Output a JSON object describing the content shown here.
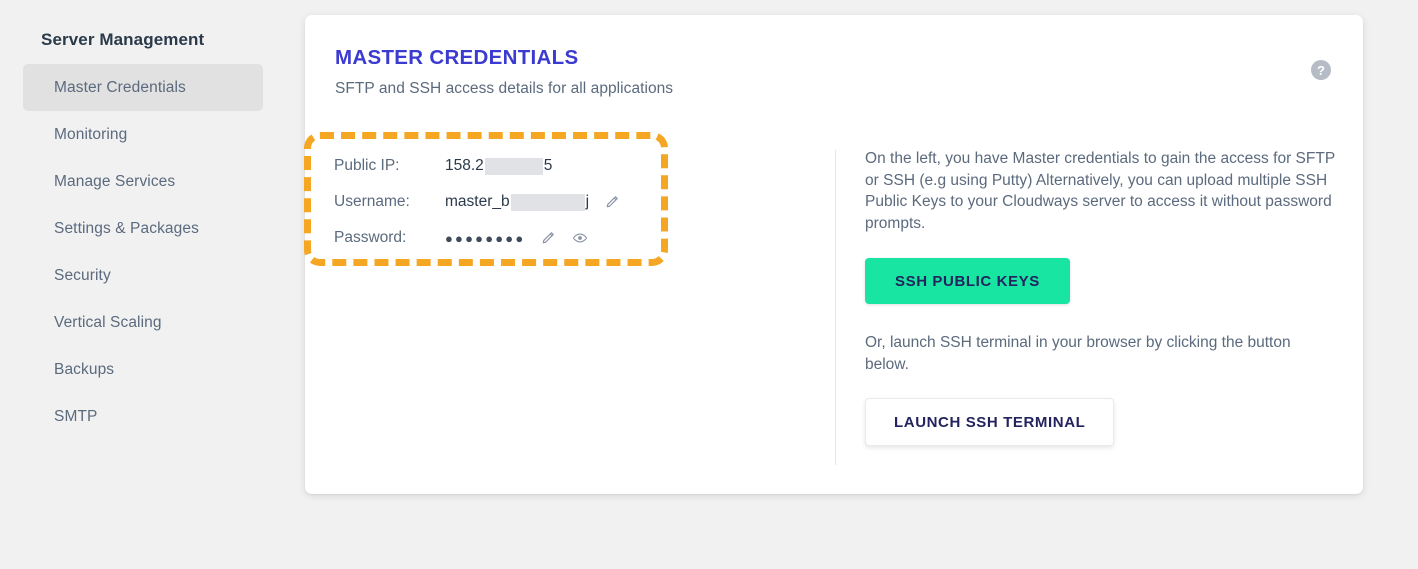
{
  "sidebar": {
    "title": "Server Management",
    "items": [
      {
        "label": "Master Credentials",
        "active": true
      },
      {
        "label": "Monitoring",
        "active": false
      },
      {
        "label": "Manage Services",
        "active": false
      },
      {
        "label": "Settings & Packages",
        "active": false
      },
      {
        "label": "Security",
        "active": false
      },
      {
        "label": "Vertical Scaling",
        "active": false
      },
      {
        "label": "Backups",
        "active": false
      },
      {
        "label": "SMTP",
        "active": false
      }
    ]
  },
  "card": {
    "title": "MASTER CREDENTIALS",
    "subtitle": "SFTP and SSH access details for all applications",
    "help_icon_glyph": "?",
    "help_icon_name": "question-mark-icon"
  },
  "credentials": {
    "rows": [
      {
        "label": "Public IP:",
        "value_prefix": "158.2",
        "value_suffix": "5",
        "redacted": true
      },
      {
        "label": "Username:",
        "value_prefix": "master_b",
        "value_suffix": "j",
        "redacted": true
      },
      {
        "label": "Password:",
        "value_masked": "●●●●●●●●",
        "redacted": false
      }
    ]
  },
  "right": {
    "description": "On the left, you have Master credentials to gain the access for SFTP or SSH (e.g using Putty) Alternatively, you can upload multiple SSH Public Keys to your Cloudways server to access it without password prompts.",
    "ssh_keys_button": "SSH PUBLIC KEYS",
    "launch_description": "Or, launch SSH terminal in your browser by clicking the button below.",
    "launch_button": "LAUNCH SSH TERMINAL"
  },
  "colors": {
    "page_background": "#f1f1f1",
    "card_background": "#ffffff",
    "title_accent": "#3b3ad1",
    "highlight_outline": "#f5a623",
    "primary_button": "#17e5a1",
    "button_text": "#23235e",
    "body_text": "#5b6a7d",
    "sidebar_active": "#e1e1e1"
  }
}
